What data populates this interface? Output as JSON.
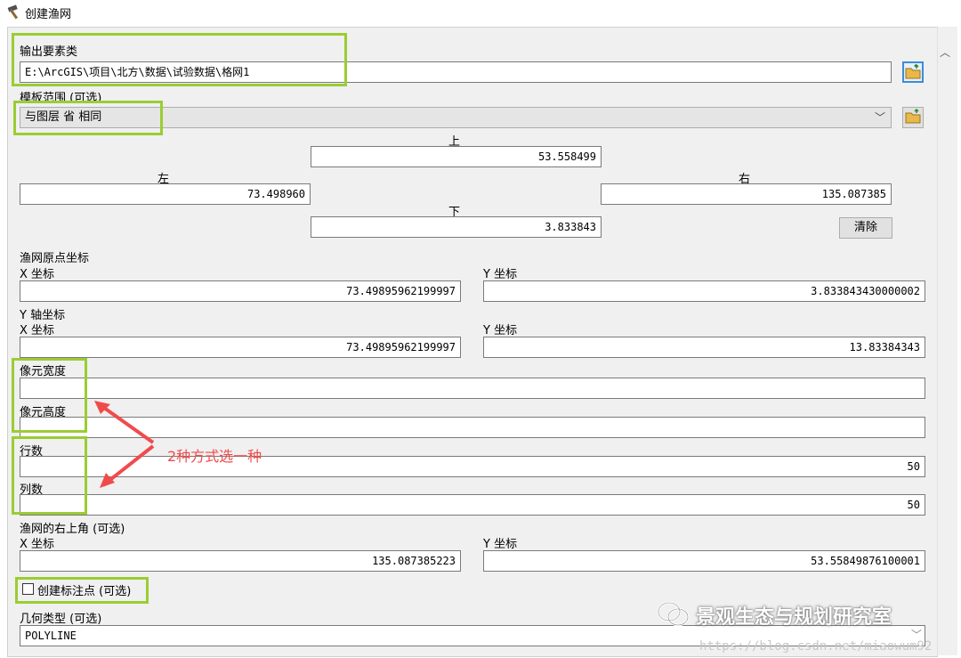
{
  "window": {
    "title": "创建渔网"
  },
  "output": {
    "label": "输出要素类",
    "value": "E:\\ArcGIS\\项目\\北方\\数据\\试验数据\\格网1"
  },
  "template": {
    "label": "模板范围 (可选)",
    "value": "与图层 省 相同"
  },
  "extent": {
    "top_label": "上",
    "top_value": "53.558499",
    "left_label": "左",
    "left_value": "73.498960",
    "right_label": "右",
    "right_value": "135.087385",
    "bottom_label": "下",
    "bottom_value": "3.833843",
    "clear_label": "清除"
  },
  "origin": {
    "label": "渔网原点坐标",
    "x_label": "X 坐标",
    "x_value": "73.49895962199997",
    "y_label": "Y 坐标",
    "y_value": "3.833843430000002"
  },
  "yaxis": {
    "label": "Y 轴坐标",
    "x_label": "X 坐标",
    "x_value": "73.49895962199997",
    "y_label": "Y 坐标",
    "y_value": "13.83384343"
  },
  "cell": {
    "width_label": "像元宽度",
    "width_value": "",
    "height_label": "像元高度",
    "height_value": ""
  },
  "rows": {
    "label": "行数",
    "value": "50"
  },
  "cols": {
    "label": "列数",
    "value": "50"
  },
  "annotation": {
    "text": "2种方式选一种",
    "color": "#f04b4b"
  },
  "corner": {
    "label": "渔网的右上角 (可选)",
    "x_label": "X 坐标",
    "x_value": "135.087385223",
    "y_label": "Y 坐标",
    "y_value": "53.55849876100001"
  },
  "label_points": {
    "label": "创建标注点 (可选)",
    "checked": false
  },
  "geometry": {
    "label": "几何类型 (可选)",
    "value": "POLYLINE"
  },
  "watermark": {
    "text": "景观生态与规划研究室",
    "url": "https://blog.csdn.net/miaowum92"
  },
  "colors": {
    "highlight": "#9acd32",
    "arrow": "#f04b4b"
  }
}
